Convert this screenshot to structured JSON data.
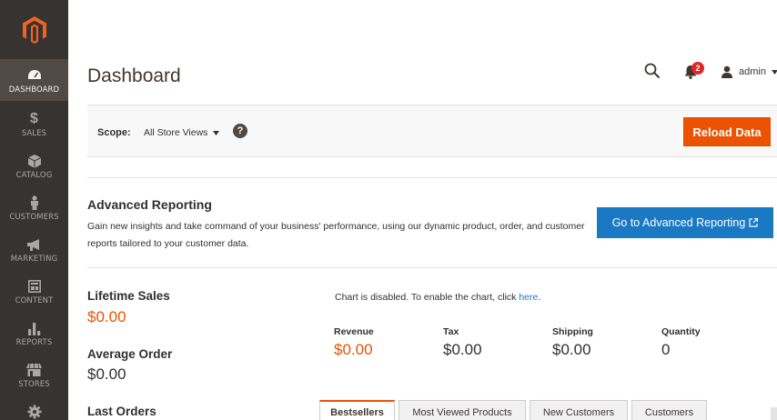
{
  "sidebar": {
    "items": [
      {
        "label": "DASHBOARD",
        "icon": "gauge-icon",
        "active": true
      },
      {
        "label": "SALES",
        "icon": "dollar-icon",
        "active": false
      },
      {
        "label": "CATALOG",
        "icon": "box-icon",
        "active": false
      },
      {
        "label": "CUSTOMERS",
        "icon": "person-icon",
        "active": false
      },
      {
        "label": "MARKETING",
        "icon": "megaphone-icon",
        "active": false
      },
      {
        "label": "CONTENT",
        "icon": "layout-icon",
        "active": false
      },
      {
        "label": "REPORTS",
        "icon": "bar-chart-icon",
        "active": false
      },
      {
        "label": "STORES",
        "icon": "storefront-icon",
        "active": false
      },
      {
        "label": "",
        "icon": "gear-icon",
        "active": false
      }
    ]
  },
  "header": {
    "title": "Dashboard",
    "notifications_count": "2",
    "user_name": "admin"
  },
  "scope": {
    "label": "Scope:",
    "selected": "All Store Views",
    "help": "?",
    "reload_label": "Reload Data"
  },
  "advanced_reporting": {
    "title": "Advanced Reporting",
    "description": "Gain new insights and take command of your business' performance, using our dynamic product, order, and customer reports tailored to your customer data.",
    "button_label": "Go to Advanced Reporting"
  },
  "stats": {
    "lifetime_sales_label": "Lifetime Sales",
    "lifetime_sales_value": "$0.00",
    "average_order_label": "Average Order",
    "average_order_value": "$0.00",
    "last_orders_label": "Last Orders"
  },
  "chart": {
    "message": "Chart is disabled. To enable the chart, click",
    "link": "here",
    "suffix": "."
  },
  "totals": [
    {
      "label": "Revenue",
      "value": "$0.00"
    },
    {
      "label": "Tax",
      "value": "$0.00"
    },
    {
      "label": "Shipping",
      "value": "$0.00"
    },
    {
      "label": "Quantity",
      "value": "0"
    }
  ],
  "tabs": [
    {
      "label": "Bestsellers",
      "active": true
    },
    {
      "label": "Most Viewed Products",
      "active": false
    },
    {
      "label": "New Customers",
      "active": false
    },
    {
      "label": "Customers",
      "active": false
    }
  ],
  "colors": {
    "accent_orange": "#eb5202",
    "link_blue": "#1979c3",
    "sidebar_bg": "#373330",
    "sidebar_active": "#514943"
  }
}
